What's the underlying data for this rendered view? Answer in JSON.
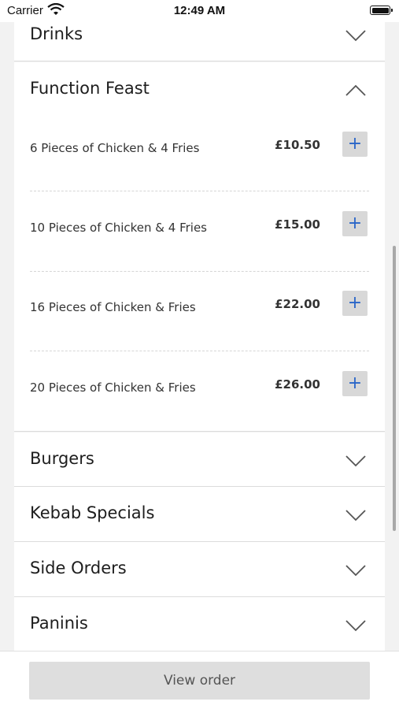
{
  "status_bar": {
    "carrier": "Carrier",
    "time": "12:49 AM"
  },
  "menu": {
    "sections": [
      {
        "title": "Drinks",
        "expanded": false
      },
      {
        "title": "Function Feast",
        "expanded": true,
        "items": [
          {
            "name": "6 Pieces of Chicken & 4 Fries",
            "price": "£10.50",
            "add": "+"
          },
          {
            "name": "10 Pieces of Chicken & 4 Fries",
            "price": "£15.00",
            "add": "+"
          },
          {
            "name": "16 Pieces of Chicken & Fries",
            "price": "£22.00",
            "add": "+"
          },
          {
            "name": "20 Pieces of Chicken & Fries",
            "price": "£26.00",
            "add": "+"
          }
        ]
      },
      {
        "title": "Burgers",
        "expanded": false
      },
      {
        "title": "Kebab Specials",
        "expanded": false
      },
      {
        "title": "Side Orders",
        "expanded": false
      },
      {
        "title": "Paninis",
        "expanded": false
      }
    ]
  },
  "footer": {
    "view_order_label": "View order"
  },
  "colors": {
    "accent": "#2a66c8",
    "button_bg": "#d8d8d8",
    "footer_button_bg": "#dedede"
  },
  "icons": {
    "expand": "chevron-down-icon",
    "collapse": "chevron-up-icon",
    "add": "plus-icon",
    "wifi": "wifi-icon",
    "battery": "battery-icon"
  }
}
